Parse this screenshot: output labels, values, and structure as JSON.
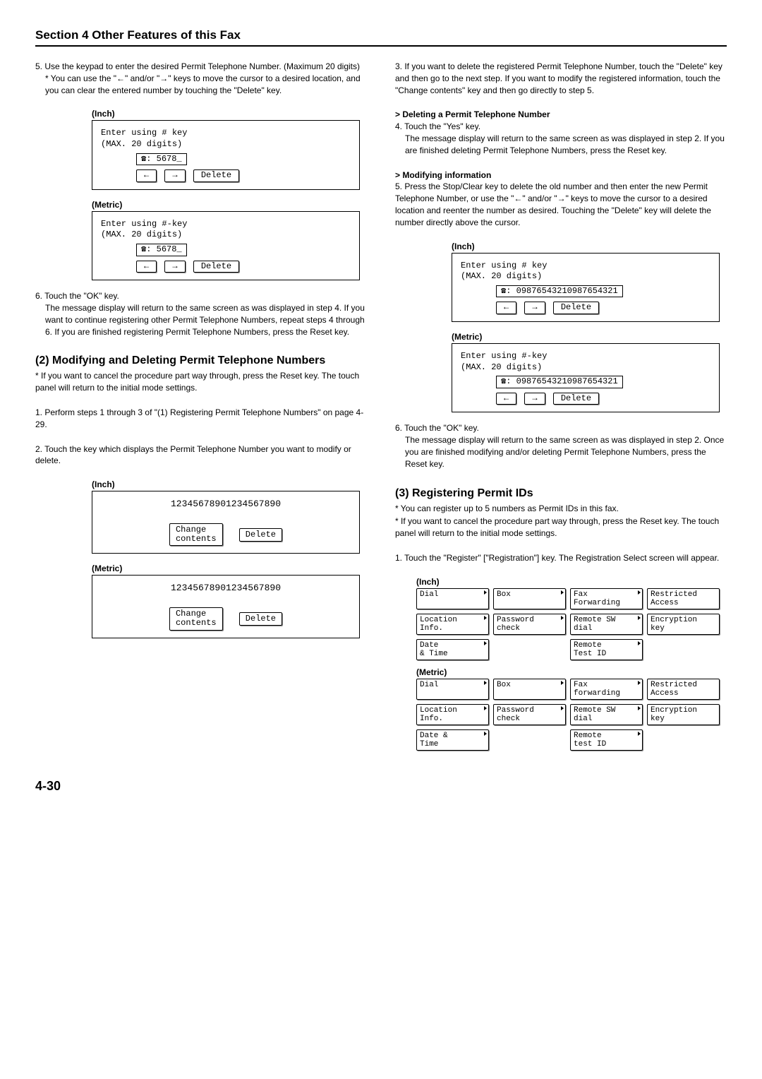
{
  "header": "Section 4 Other Features of this Fax",
  "left": {
    "p5": "5. Use the keypad to enter the desired Permit Telephone Number. (Maximum 20 digits)",
    "p5note": "* You can use the \"←\" and/or \"→\" keys to move the cursor to a desired location, and you can clear the entered number by touching the \"Delete\" key.",
    "inch": "(Inch)",
    "metric": "(Metric)",
    "panelA": {
      "l1_inch": "Enter using # key",
      "l1_metric": "Enter using #-key",
      "l2": "(MAX. 20 digits)",
      "phone": "☎: 5678_",
      "left": "←",
      "right": "→",
      "delete": "Delete"
    },
    "p6": "6. Touch the \"OK\" key.",
    "p6b": "The message display will return to the same screen as was displayed in step 4. If you want to continue registering other Permit Telephone Numbers, repeat steps 4 through 6. If you are finished registering Permit Telephone Numbers, press the Reset key.",
    "h2": "(2) Modifying and Deleting Permit Telephone Numbers",
    "h2note": "* If you want to cancel the procedure part way through, press the Reset key. The touch panel will return to the initial mode settings.",
    "p1": "1. Perform steps 1 through 3 of \"(1) Registering Permit Telephone Numbers\" on page 4-29.",
    "p2": "2. Touch the key which displays the Permit Telephone Number you want to modify or delete.",
    "panelB": {
      "number": "12345678901234567890",
      "change": "Change\ncontents",
      "delete": "Delete"
    }
  },
  "right": {
    "p3": "3. If you want to delete the registered Permit Telephone Number, touch the \"Delete\" key and then go to the next step. If you want to modify the registered information, touch the \"Change contents\" key and then go directly to step 5.",
    "hDel": "> Deleting a Permit Telephone Number",
    "p4": "4. Touch the \"Yes\" key.",
    "p4b": "The message display will return to the same screen as was displayed in step 2. If you are finished deleting Permit Telephone Numbers, press the Reset key.",
    "hMod": "> Modifying information",
    "p5": "5. Press the Stop/Clear key to delete the old number and then enter the new Permit Telephone Number, or use the \"←\" and/or \"→\" keys to move the cursor to a desired location and reenter the number as desired. Touching the \"Delete\" key will delete the number directly above the cursor.",
    "inch": "(Inch)",
    "metric": "(Metric)",
    "panelC": {
      "l1_inch": "Enter using # key",
      "l1_metric": "Enter using #-key",
      "l2": "(MAX. 20 digits)",
      "phone": "☎: 09876543210987654321",
      "left": "←",
      "right": "→",
      "delete": "Delete"
    },
    "p6": "6. Touch the \"OK\" key.",
    "p6b": "The message display will return to the same screen as was displayed in step 2. Once you are finished modifying and/or deleting Permit Telephone Numbers, press the Reset key.",
    "h3": "(3) Registering Permit IDs",
    "h3n1": "* You can register up to 5 numbers as Permit IDs in this fax.",
    "h3n2": "* If you want to cancel the procedure part way through, press the Reset key. The touch panel will return to the initial mode settings.",
    "p1b": "1. Touch the \"Register\" [\"Registration\"] key. The Registration Select screen will appear.",
    "gridInch": {
      "r1": [
        "Dial",
        "Box",
        "Fax\nForwarding",
        "Restricted\nAccess"
      ],
      "r2": [
        "Location\nInfo.",
        "Password\ncheck",
        "Remote SW\ndial",
        "Encryption\nkey"
      ],
      "r3": [
        "Date\n& Time",
        "",
        "Remote\nTest ID",
        ""
      ]
    },
    "gridMetric": {
      "r1": [
        "Dial",
        "Box",
        "Fax\nforwarding",
        "Restricted\nAccess"
      ],
      "r2": [
        "Location\nInfo.",
        "Password\ncheck",
        "Remote SW\ndial",
        "Encryption\nkey"
      ],
      "r3": [
        "Date &\nTime",
        "",
        "Remote\ntest ID",
        ""
      ]
    }
  },
  "pageNum": "4-30"
}
